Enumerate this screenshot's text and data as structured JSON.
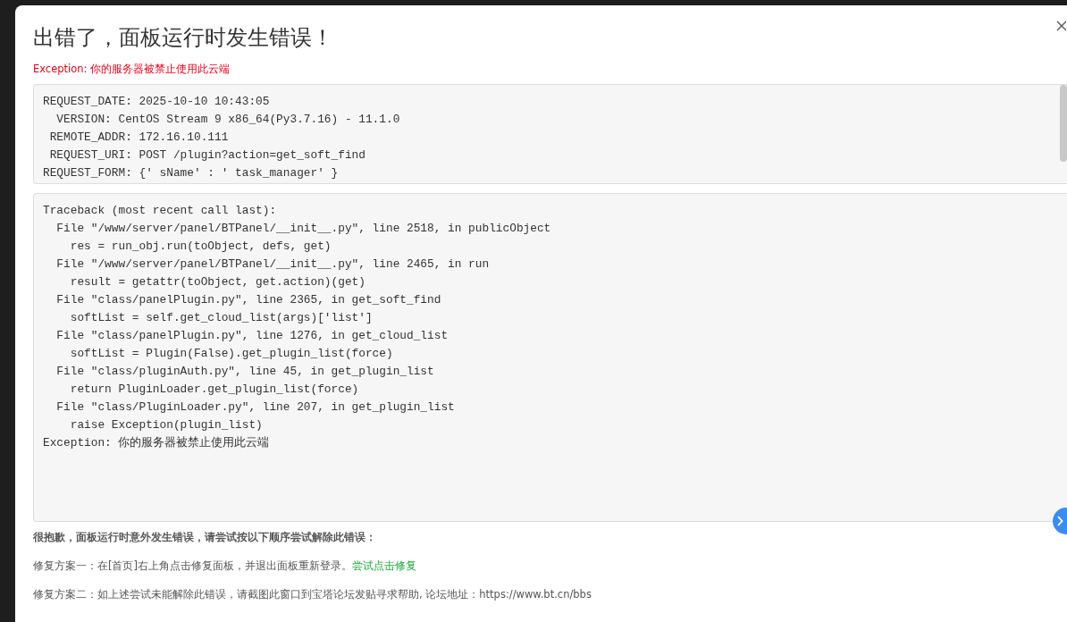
{
  "dialog": {
    "title": "出错了，面板运行时发生错误！",
    "exception": "Exception: 你的服务器被禁止使用此云端"
  },
  "request_info": [
    "REQUEST_DATE: 2025-10-10 10:43:05",
    "  VERSION: CentOS Stream 9 x86_64(Py3.7.16) - 11.1.0",
    " REMOTE_ADDR: 172.16.10.111",
    " REQUEST_URI: POST /plugin?action=get_soft_find",
    "REQUEST_FORM: {' sName' : ' task_manager' }"
  ],
  "traceback": [
    "Traceback (most recent call last):",
    "  File \"/www/server/panel/BTPanel/__init__.py\", line 2518, in publicObject",
    "    res = run_obj.run(toObject, defs, get)",
    "  File \"/www/server/panel/BTPanel/__init__.py\", line 2465, in run",
    "    result = getattr(toObject, get.action)(get)",
    "  File \"class/panelPlugin.py\", line 2365, in get_soft_find",
    "    softList = self.get_cloud_list(args)['list']",
    "  File \"class/panelPlugin.py\", line 1276, in get_cloud_list",
    "    softList = Plugin(False).get_plugin_list(force)",
    "  File \"class/pluginAuth.py\", line 45, in get_plugin_list",
    "    return PluginLoader.get_plugin_list(force)",
    "  File \"class/PluginLoader.py\", line 207, in get_plugin_list",
    "    raise Exception(plugin_list)",
    "Exception: 你的服务器被禁止使用此云端"
  ],
  "help": {
    "heading": "很抱歉，面板运行时意外发生错误，请尝试按以下顺序尝试解除此错误：",
    "fixes": [
      {
        "text": "修复方案一：在[首页]右上角点击修复面板，并退出面板重新登录。",
        "link": "尝试点击修复"
      },
      {
        "text": "修复方案二：如上述尝试未能解除此错误，请截图此窗口到宝塔论坛发贴寻求帮助, 论坛地址：https://www.bt.cn/bbs"
      }
    ]
  }
}
